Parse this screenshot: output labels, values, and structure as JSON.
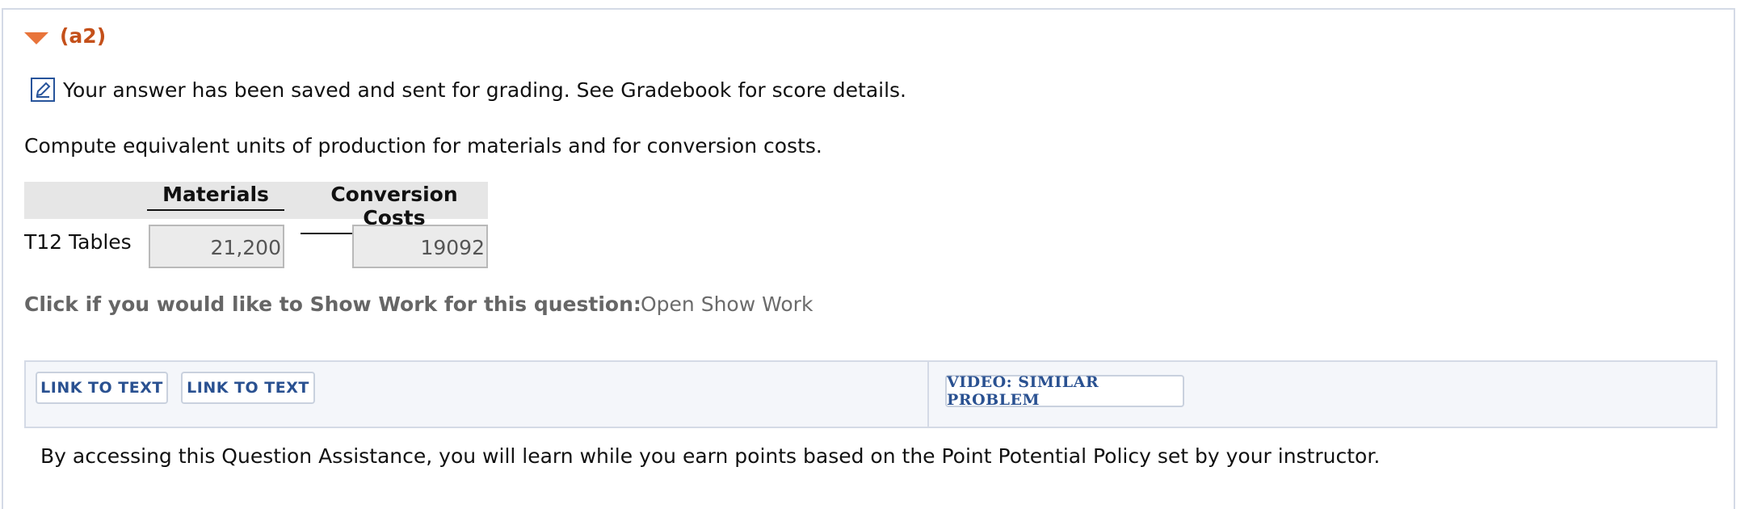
{
  "section": {
    "title": "(a2)",
    "toggle_icon": "collapse-triangle-icon",
    "accent_color": "#c4501a"
  },
  "status": {
    "icon": "edit-pencil-icon",
    "message": "Your answer has been saved and sent for grading. See Gradebook for score details."
  },
  "question": {
    "instruction": "Compute equivalent units of production for materials and for conversion costs.",
    "columns": [
      "Materials",
      "Conversion Costs"
    ],
    "rows": [
      {
        "label": "T12 Tables",
        "materials": "21,200",
        "conversion": "19092"
      }
    ]
  },
  "show_work": {
    "label": "Click if you would like to Show Work for this question:",
    "link": "Open Show Work"
  },
  "assistance": {
    "buttons": [
      "LINK TO TEXT",
      "LINK TO TEXT"
    ],
    "video_button": "VIDEO: SIMILAR PROBLEM",
    "policy_text": "By accessing this Question Assistance, you will learn while you earn points based on the Point Potential Policy set by your instructor."
  }
}
